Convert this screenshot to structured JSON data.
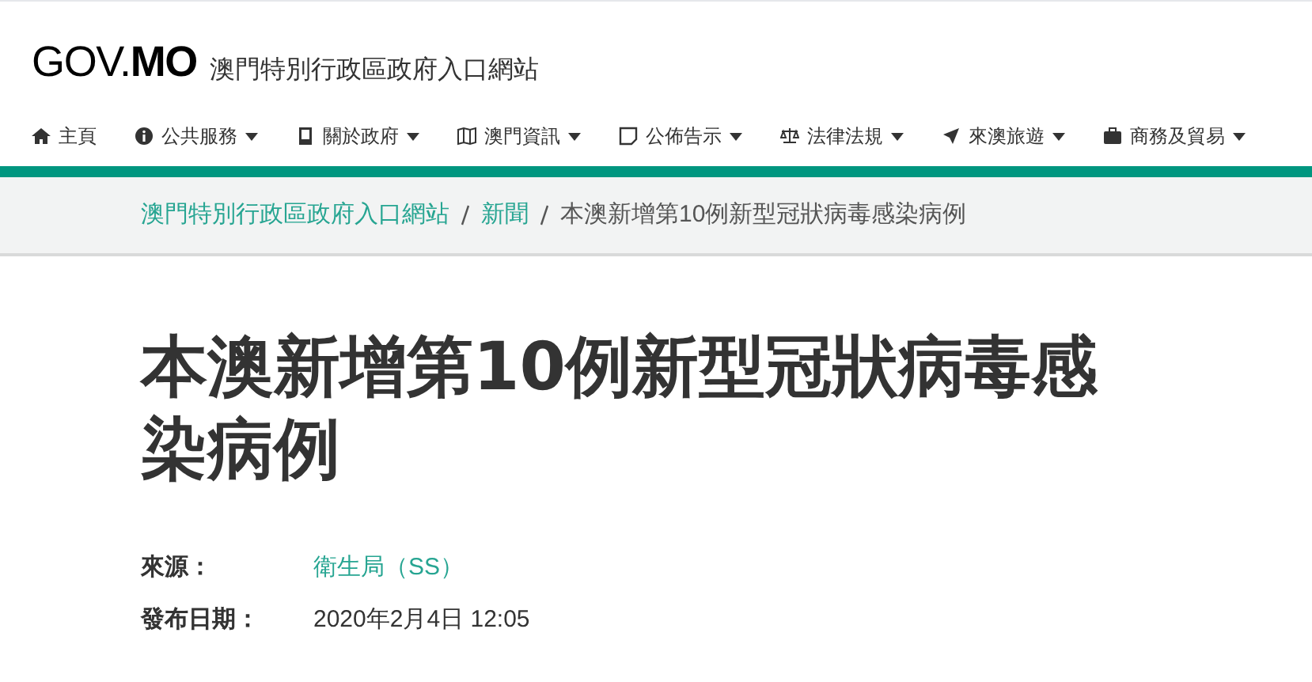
{
  "header": {
    "logo": "GOV.**MO**",
    "site_name": "澳門特別行政區政府入口網站"
  },
  "nav": [
    {
      "label": "主頁",
      "kind": "home",
      "dropdown": false
    },
    {
      "label": "公共服務",
      "kind": "info",
      "dropdown": true
    },
    {
      "label": "關於政府",
      "kind": "building",
      "dropdown": true
    },
    {
      "label": "澳門資訊",
      "kind": "map",
      "dropdown": true
    },
    {
      "label": "公佈告示",
      "kind": "note",
      "dropdown": true
    },
    {
      "label": "法律法規",
      "kind": "scale",
      "dropdown": true
    },
    {
      "label": "來澳旅遊",
      "kind": "plane",
      "dropdown": true
    },
    {
      "label": "商務及貿易",
      "kind": "briefcase",
      "dropdown": true
    }
  ],
  "breadcrumb": [
    {
      "label": "澳門特別行政區政府入口網站",
      "link": true
    },
    {
      "label": "新聞",
      "link": true
    },
    {
      "label": "本澳新增第10例新型冠狀病毒感染病例",
      "link": false
    }
  ],
  "title": "本澳新增第10例新型冠狀病毒感染病例",
  "meta": [
    {
      "label": "來源：",
      "value": "衛生局（SS）",
      "link": true
    },
    {
      "label": "發布日期：",
      "value": "2020年2月4日 12:05",
      "link": false
    }
  ]
}
